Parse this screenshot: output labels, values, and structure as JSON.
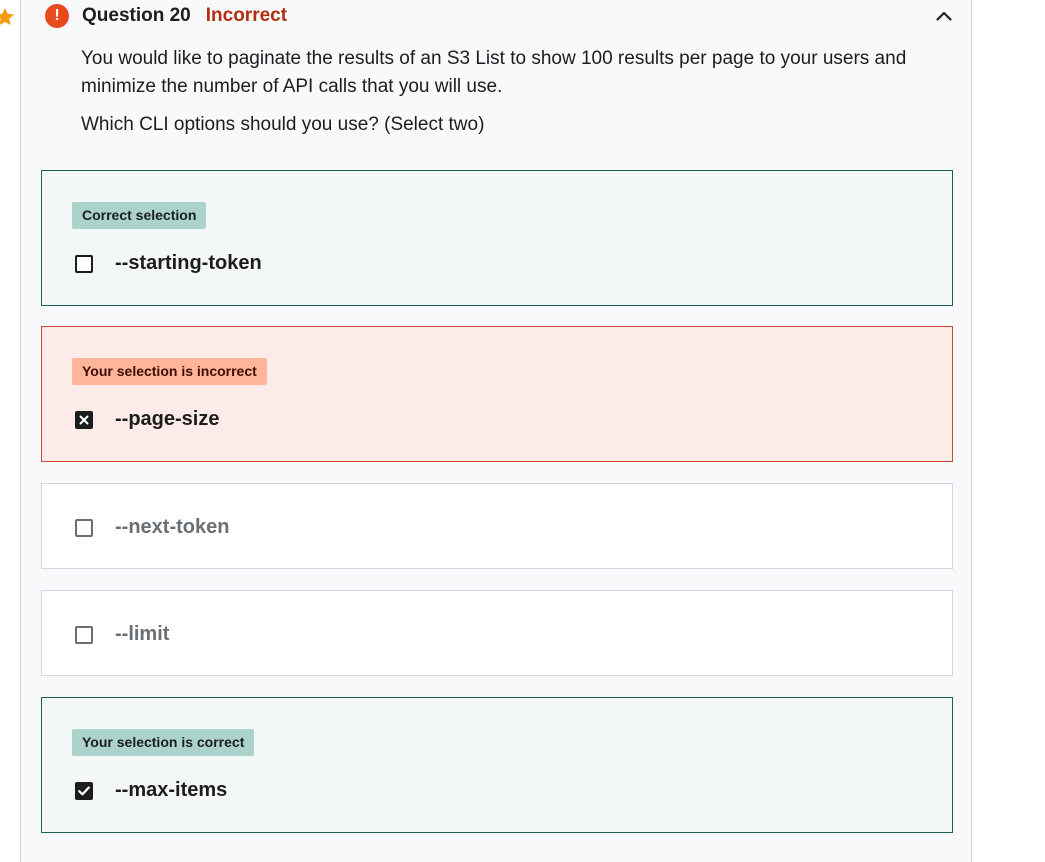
{
  "question": {
    "title": "Question 20",
    "status": "Incorrect",
    "text": "You would like to paginate the results of an S3 List to show 100 results per page to your users and minimize the number of API calls that you will use.",
    "prompt": "Which CLI options should you use? (Select two)"
  },
  "icons": {
    "star": "star-icon",
    "alert": "alert-icon",
    "collapse": "chevron-up-icon",
    "alert_glyph": "!"
  },
  "options": [
    {
      "badge": "Correct selection",
      "label": "--starting-token",
      "state": "correct",
      "checked": false
    },
    {
      "badge": "Your selection is incorrect",
      "label": "--page-size",
      "state": "incorrect",
      "checked": true
    },
    {
      "badge": "",
      "label": "--next-token",
      "state": "neutral",
      "checked": false
    },
    {
      "badge": "",
      "label": "--limit",
      "state": "neutral",
      "checked": false
    },
    {
      "badge": "Your selection is correct",
      "label": "--max-items",
      "state": "correct",
      "checked": true
    }
  ],
  "colors": {
    "incorrect_text": "#b32d0f",
    "alert": "#e8491d",
    "correct_border": "#1e6055",
    "incorrect_border": "#c9462f",
    "star": "#f69c08"
  }
}
